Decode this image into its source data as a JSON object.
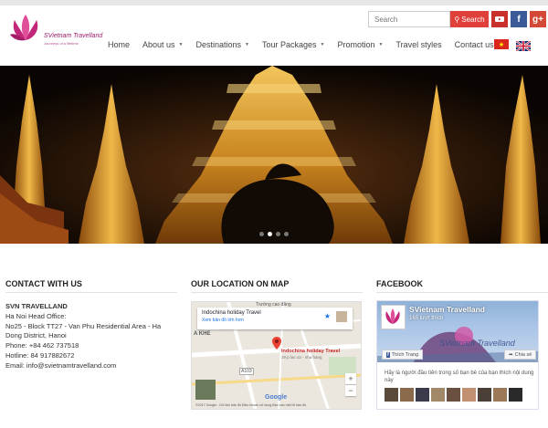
{
  "header": {
    "logo_title": "SVietnam Travelland",
    "logo_tagline": "Journeys of a lifetime"
  },
  "search": {
    "placeholder": "Search",
    "button_label": "Search"
  },
  "social": {
    "youtube_label": "You Tube",
    "facebook_label": "f",
    "google_label": "g+"
  },
  "nav": {
    "items": [
      {
        "label": "Home",
        "dropdown": false
      },
      {
        "label": "About us",
        "dropdown": true
      },
      {
        "label": "Destinations",
        "dropdown": true
      },
      {
        "label": "Tour Packages",
        "dropdown": true
      },
      {
        "label": "Promotion",
        "dropdown": true
      },
      {
        "label": "Travel styles",
        "dropdown": false
      },
      {
        "label": "Contact us",
        "dropdown": false
      }
    ]
  },
  "slider": {
    "slide_count": 4,
    "active_index": 1
  },
  "contact": {
    "title": "CONTACT WITH US",
    "company": "SVN TRAVELLAND",
    "office_label": "Ha Noi Head Office:",
    "address_line1": "No25 - Block TT27 - Van Phu Residential Area - Ha",
    "address_line2": "Dong District, Hanoi",
    "phone": "Phone: +84 462 737518",
    "hotline": "Hotline: 84 917882672",
    "email": "Email:   info@svietnamtravelland.com"
  },
  "map": {
    "title": "OUR LOCATION ON MAP",
    "card_title": "Indochina holiday Travel",
    "card_link": "Xem bản đồ lớn hơn",
    "pin_title": "Indochina holiday Travel",
    "pin_sub": "29 p lac xa - nha hang",
    "label_road": "Trường cao đẳng",
    "label_khe": "A KHE",
    "label_road2": "A103",
    "google": "Google",
    "footer": "©2017 Google - Dữ liệu bản đồ   Điều khoản sử dụng   Báo cáo một lỗi bản đồ",
    "zoom_in": "+",
    "zoom_out": "−"
  },
  "facebook": {
    "title": "FACEBOOK",
    "page_name": "SVietnam Travelland",
    "likes": "165 lượt thích",
    "cover_text": "SVietnam Travelland",
    "like_button": "Thích Trang",
    "share_button": "Chia sẻ",
    "invite": "Hãy là người đầu tiên trong số bạn bè của bạn thích nội dung này"
  }
}
